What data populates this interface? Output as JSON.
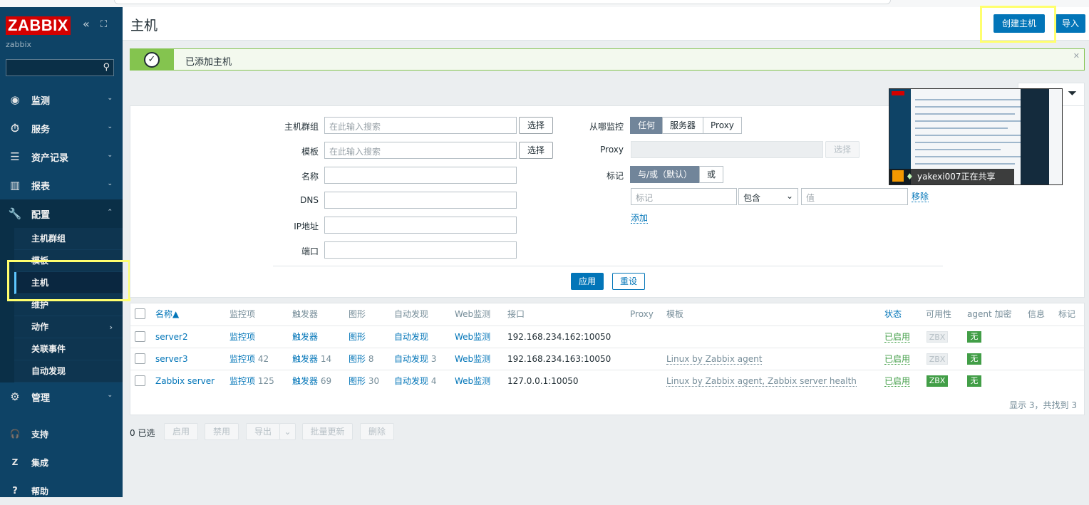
{
  "app": {
    "logo": "ZABBIX",
    "server_name": "zabbix"
  },
  "sidebar": {
    "collapse_icon": "«",
    "kiosk_icon": "⛶",
    "items": [
      {
        "label": "监测",
        "icon": "eye-icon"
      },
      {
        "label": "服务",
        "icon": "clock-icon"
      },
      {
        "label": "资产记录",
        "icon": "list-icon"
      },
      {
        "label": "报表",
        "icon": "chart-icon"
      },
      {
        "label": "配置",
        "icon": "wrench-icon"
      }
    ],
    "config_sub": [
      "主机群组",
      "模板",
      "主机",
      "维护",
      "动作",
      "关联事件",
      "自动发现"
    ],
    "admin": {
      "label": "管理",
      "icon": "gear-icon"
    },
    "support": "支持",
    "integrations": "集成",
    "help": "帮助"
  },
  "header": {
    "title": "主机",
    "create": "创建主机",
    "import": "导入"
  },
  "message": {
    "text": "已添加主机"
  },
  "filter": {
    "host_groups_label": "主机群组",
    "templates_label": "模板",
    "name_label": "名称",
    "dns_label": "DNS",
    "ip_label": "IP地址",
    "port_label": "端口",
    "search_placeholder": "在此输入搜索",
    "select": "选择",
    "monitored_by_label": "从哪监控",
    "monitored_by": [
      "任何",
      "服务器",
      "Proxy"
    ],
    "proxy_label": "Proxy",
    "tags_label": "标记",
    "tags_mode": [
      "与/或（默认）",
      "或"
    ],
    "tag_placeholder": "标记",
    "tag_operator": "包含",
    "value_placeholder": "值",
    "remove": "移除",
    "add": "添加",
    "apply": "应用",
    "reset": "重设"
  },
  "share": {
    "text": "yakexi007正在共享"
  },
  "table": {
    "columns": [
      "名称▲",
      "监控项",
      "触发器",
      "图形",
      "自动发现",
      "Web监测",
      "接口",
      "Proxy",
      "模板",
      "状态",
      "可用性",
      "agent 加密",
      "信息",
      "标记"
    ],
    "rows": [
      {
        "name": "server2",
        "items": "监控项",
        "items_n": "",
        "triggers": "触发器",
        "triggers_n": "",
        "graphs": "图形",
        "graphs_n": "",
        "discovery": "自动发现",
        "discovery_n": "",
        "web": "Web监测",
        "interface": "192.168.234.162:10050",
        "templates": "",
        "status": "已启用",
        "zbx": "ZBX",
        "enc": "无"
      },
      {
        "name": "server3",
        "items": "监控项",
        "items_n": "42",
        "triggers": "触发器",
        "triggers_n": "14",
        "graphs": "图形",
        "graphs_n": "8",
        "discovery": "自动发现",
        "discovery_n": "3",
        "web": "Web监测",
        "interface": "192.168.234.163:10050",
        "templates": "Linux by Zabbix agent",
        "status": "已启用",
        "zbx": "ZBX",
        "enc": "无"
      },
      {
        "name": "Zabbix server",
        "items": "监控项",
        "items_n": "125",
        "triggers": "触发器",
        "triggers_n": "69",
        "graphs": "图形",
        "graphs_n": "30",
        "discovery": "自动发现",
        "discovery_n": "4",
        "web": "Web监测",
        "interface": "127.0.0.1:10050",
        "templates": "Linux by Zabbix agent, Zabbix server health",
        "status": "已启用",
        "zbx": "ZBX",
        "enc": "无"
      }
    ],
    "footer": "显示 3，共找到 3"
  },
  "bulk": {
    "selected": "0 已选",
    "enable": "启用",
    "disable": "禁用",
    "export": "导出",
    "mass_update": "批量更新",
    "delete": "删除"
  }
}
